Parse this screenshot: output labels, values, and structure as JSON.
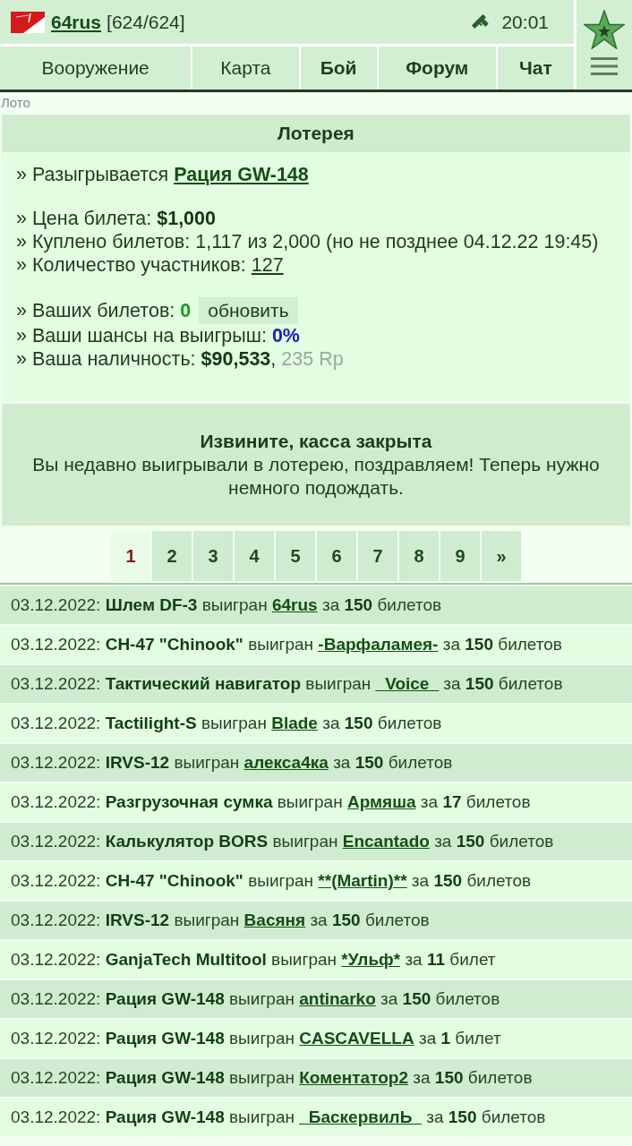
{
  "header": {
    "user_name": "64rus",
    "user_counter": "[624/624]",
    "time": "20:01"
  },
  "nav_tabs": [
    {
      "label": "Вооружение",
      "emphasized": false
    },
    {
      "label": "Карта",
      "emphasized": false
    },
    {
      "label": "Бой",
      "emphasized": true
    },
    {
      "label": "Форум",
      "emphasized": true
    },
    {
      "label": "Чат",
      "emphasized": true
    }
  ],
  "breadcrumb": "Лото",
  "lottery": {
    "title": "Лотерея",
    "groups": [
      [
        {
          "kind": "prize",
          "label": "» Разыгрывается",
          "value": "Рация GW-148"
        }
      ],
      [
        {
          "kind": "bold",
          "label": "» Цена билета:",
          "value": "$1,000"
        },
        {
          "kind": "plain",
          "label": "» Куплено билетов: 1,117 из 2,000 (но не позднее 04.12.22 19:45)"
        },
        {
          "kind": "link",
          "label": "» Количество участников:",
          "value": "127"
        }
      ],
      [
        {
          "kind": "tickets",
          "label": "» Ваших билетов:",
          "value": "0",
          "button": "обновить"
        },
        {
          "kind": "chance",
          "label": "» Ваши шансы на выигрыш:",
          "value": "0%"
        },
        {
          "kind": "cash",
          "label": "» Ваша наличность:",
          "value": "$90,533",
          "separator": ",",
          "extra": "235 Rp"
        }
      ]
    ]
  },
  "notice": {
    "title": "Извините, касса закрыта",
    "message": "Вы недавно выигрывали в лотерею, поздравляем! Теперь нужно немного подождать."
  },
  "pagination": {
    "pages": [
      {
        "label": "1",
        "selected": true
      },
      {
        "label": "2",
        "selected": false
      },
      {
        "label": "3",
        "selected": false
      },
      {
        "label": "4",
        "selected": false
      },
      {
        "label": "5",
        "selected": false
      },
      {
        "label": "6",
        "selected": false
      },
      {
        "label": "7",
        "selected": false
      },
      {
        "label": "8",
        "selected": false
      },
      {
        "label": "9",
        "selected": false
      }
    ],
    "next": "»"
  },
  "history": [
    {
      "date": "03.12.2022:",
      "item": "Шлем DF-3",
      "verb": "выигран",
      "winner": "64rus",
      "prep": "за",
      "count": "150",
      "unit": "билетов"
    },
    {
      "date": "03.12.2022:",
      "item": "CH-47 \"Chinook\"",
      "verb": "выигран",
      "winner": "-Варфаламея-",
      "prep": "за",
      "count": "150",
      "unit": "билетов"
    },
    {
      "date": "03.12.2022:",
      "item": "Тактический навигатор",
      "verb": "выигран",
      "winner": "_Voice_",
      "prep": "за",
      "count": "150",
      "unit": "билетов"
    },
    {
      "date": "03.12.2022:",
      "item": "Tactilight-S",
      "verb": "выигран",
      "winner": "Blade",
      "prep": "за",
      "count": "150",
      "unit": "билетов"
    },
    {
      "date": "03.12.2022:",
      "item": "IRVS-12",
      "verb": "выигран",
      "winner": "алекса4ка",
      "prep": "за",
      "count": "150",
      "unit": "билетов"
    },
    {
      "date": "03.12.2022:",
      "item": "Разгрузочная сумка",
      "verb": "выигран",
      "winner": "Армяша",
      "prep": "за",
      "count": "17",
      "unit": "билетов"
    },
    {
      "date": "03.12.2022:",
      "item": "Калькулятор BORS",
      "verb": "выигран",
      "winner": "Encantado",
      "prep": "за",
      "count": "150",
      "unit": "билетов"
    },
    {
      "date": "03.12.2022:",
      "item": "CH-47 \"Chinook\"",
      "verb": "выигран",
      "winner": "**(Martin)**",
      "prep": "за",
      "count": "150",
      "unit": "билетов"
    },
    {
      "date": "03.12.2022:",
      "item": "IRVS-12",
      "verb": "выигран",
      "winner": "Васяня",
      "prep": "за",
      "count": "150",
      "unit": "билетов"
    },
    {
      "date": "03.12.2022:",
      "item": "GanjaTech Multitool",
      "verb": "выигран",
      "winner": "*Ульф*",
      "prep": "за",
      "count": "11",
      "unit": "билет"
    },
    {
      "date": "03.12.2022:",
      "item": "Рация GW-148",
      "verb": "выигран",
      "winner": "antinarko",
      "prep": "за",
      "count": "150",
      "unit": "билетов"
    },
    {
      "date": "03.12.2022:",
      "item": "Рация GW-148",
      "verb": "выигран",
      "winner": "CASCAVELLA",
      "prep": "за",
      "count": "1",
      "unit": "билет"
    },
    {
      "date": "03.12.2022:",
      "item": "Рация GW-148",
      "verb": "выигран",
      "winner": "Коментатор2",
      "prep": "за",
      "count": "150",
      "unit": "билетов"
    },
    {
      "date": "03.12.2022:",
      "item": "Рация GW-148",
      "verb": "выигран",
      "winner": "_БаскервилЬ_",
      "prep": "за",
      "count": "150",
      "unit": "билетов"
    }
  ]
}
